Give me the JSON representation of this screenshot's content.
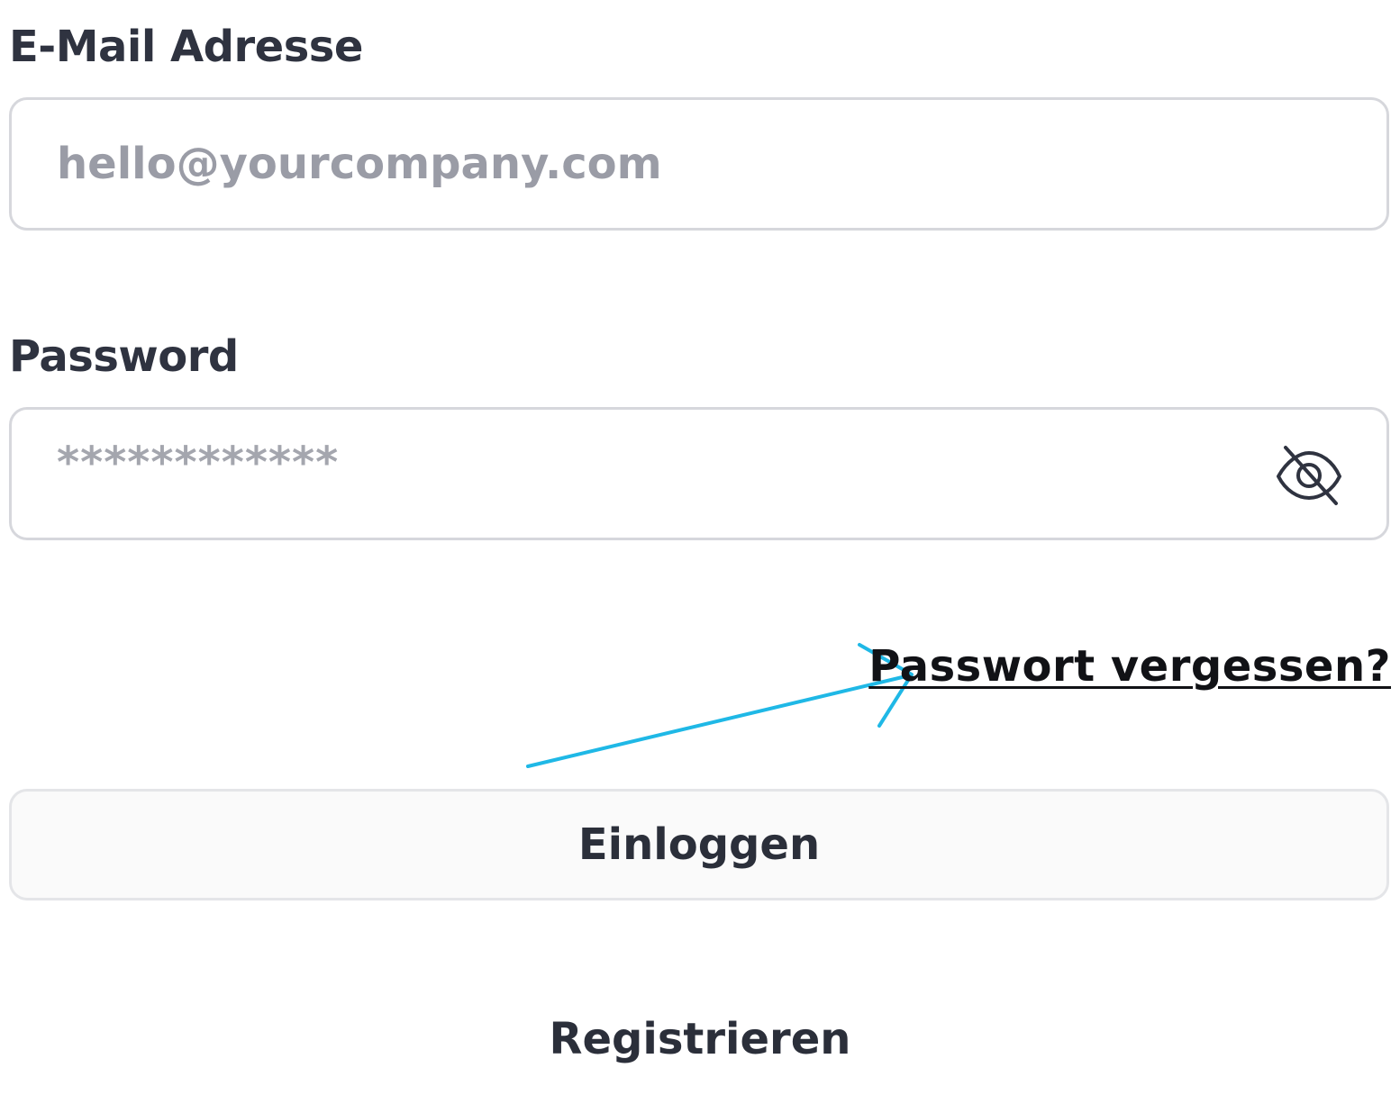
{
  "email": {
    "label": "E-Mail Adresse",
    "placeholder": "hello@yourcompany.com"
  },
  "password": {
    "label": "Password",
    "placeholder": "************",
    "toggle_icon": "eye-slash-icon"
  },
  "forgot_password": {
    "label": "Passwort vergessen?"
  },
  "annotation": {
    "icon": "arrow-icon",
    "color": "#1fb8e6"
  },
  "login_button": {
    "label": "Einloggen"
  },
  "register_link": {
    "label": "Registrieren"
  }
}
